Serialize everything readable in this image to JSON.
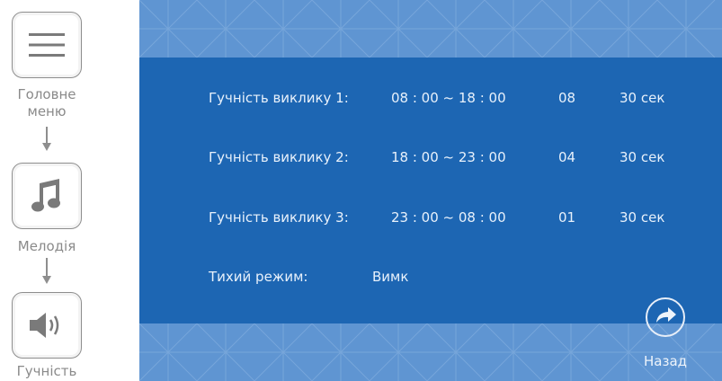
{
  "nav": {
    "main_menu_label": "Головне меню",
    "melody_label": "Мелодія",
    "volume_label": "Гучність"
  },
  "settings": {
    "rows": [
      {
        "label": "Гучність виклику 1:",
        "time": "08 : 00 ~ 18 : 00",
        "level": "08",
        "duration": "30 сек"
      },
      {
        "label": "Гучність виклику 2:",
        "time": "18 : 00 ~ 23 : 00",
        "level": "04",
        "duration": "30 сек"
      },
      {
        "label": "Гучність виклику 3:",
        "time": "23 : 00 ~ 08 : 00",
        "level": "01",
        "duration": "30 сек"
      }
    ],
    "silent_label": "Тихий режим:",
    "silent_value": "Вимк"
  },
  "back_label": "Назад",
  "icons": {
    "menu": "menu-icon",
    "melody": "music-note-icon",
    "volume": "speaker-icon",
    "back": "arrow-right-icon"
  },
  "colors": {
    "panel": "#1d66b3",
    "band": "#5f95d2",
    "text": "#e8f1fb",
    "nav_gray": "#8e8e8e"
  }
}
